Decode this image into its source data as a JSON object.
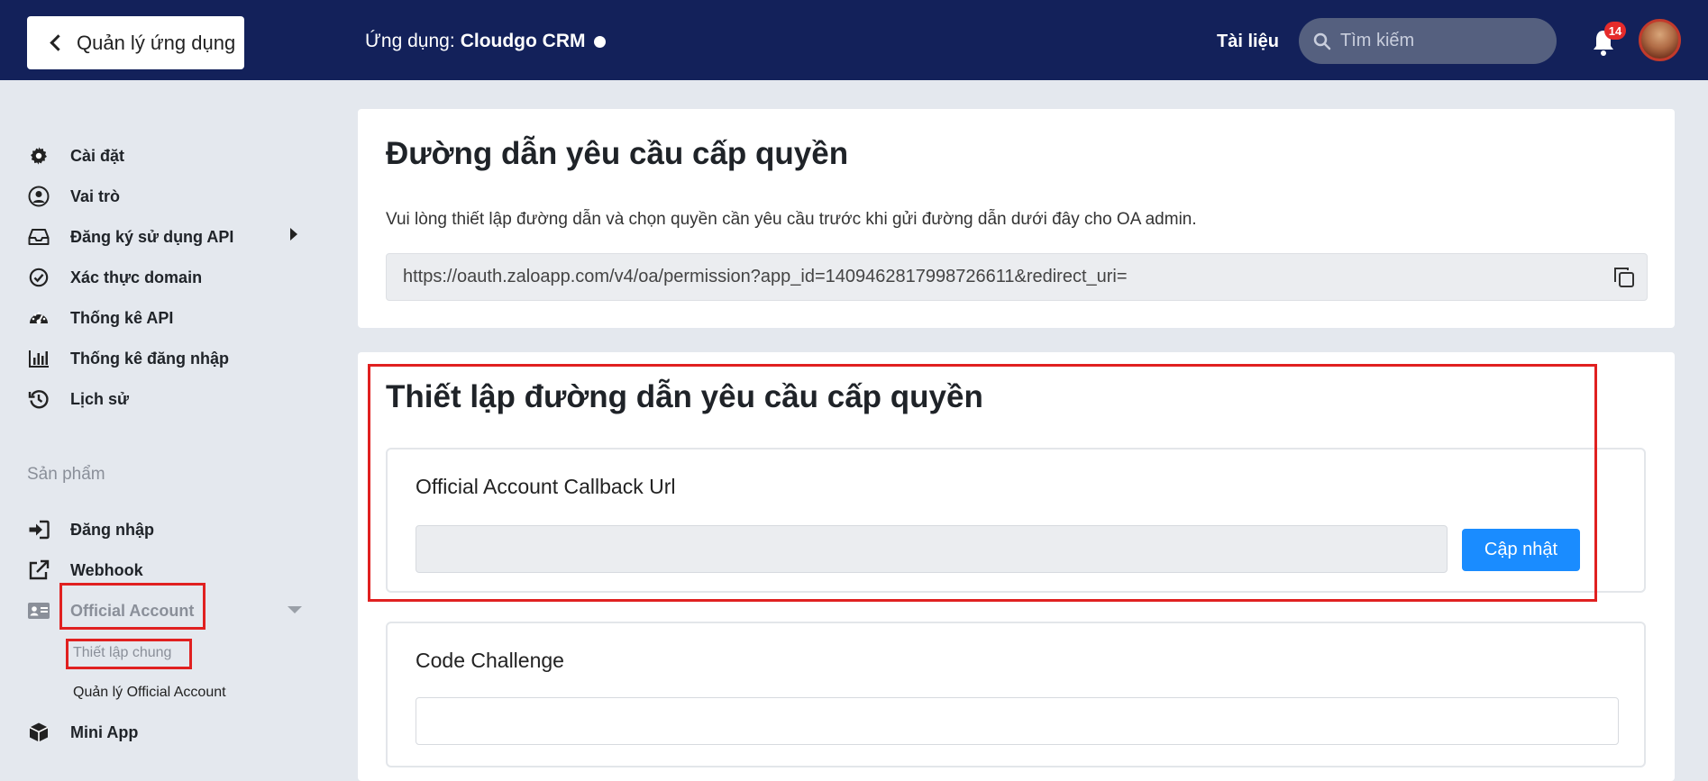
{
  "header": {
    "back_label": "Quản lý ứng dụng",
    "app_prefix": "Ứng dụng:",
    "app_name": "Cloudgo CRM",
    "docs_label": "Tài liệu",
    "search_placeholder": "Tìm kiếm",
    "notification_count": "14"
  },
  "sidebar": {
    "items": [
      {
        "label": "Cài đặt",
        "icon": "gear-icon"
      },
      {
        "label": "Vai trò",
        "icon": "user-circle-icon"
      },
      {
        "label": "Đăng ký sử dụng API",
        "icon": "inbox-icon"
      },
      {
        "label": "Xác thực domain",
        "icon": "check-circle-icon"
      },
      {
        "label": "Thống kê API",
        "icon": "dashboard-icon"
      },
      {
        "label": "Thống kê đăng nhập",
        "icon": "bar-chart-icon"
      },
      {
        "label": "Lịch sử",
        "icon": "history-icon"
      }
    ],
    "section_label": "Sản phẩm",
    "products": [
      {
        "label": "Đăng nhập",
        "icon": "sign-in-icon"
      },
      {
        "label": "Webhook",
        "icon": "external-link-icon"
      },
      {
        "label": "Official Account",
        "icon": "id-card-icon"
      },
      {
        "label": "Mini App",
        "icon": "cube-icon"
      }
    ],
    "oa_sub": {
      "general_settings": "Thiết lập chung",
      "manage_oa": "Quản lý Official Account"
    }
  },
  "permission_card": {
    "title": "Đường dẫn yêu cầu cấp quyền",
    "description": "Vui lòng thiết lập đường dẫn và chọn quyền cần yêu cầu trước khi gửi đường dẫn dưới đây cho OA admin.",
    "url": "https://oauth.zaloapp.com/v4/oa/permission?app_id=1409462817998726611&redirect_uri="
  },
  "setup_card": {
    "title": "Thiết lập đường dẫn yêu cầu cấp quyền",
    "callback_title": "Official Account Callback Url",
    "callback_value": "",
    "update_label": "Cập nhật",
    "code_challenge_title": "Code Challenge",
    "code_challenge_value": ""
  },
  "colors": {
    "header_bg": "#13215a",
    "page_bg": "#e4e8ee",
    "accent": "#1a8cff",
    "highlight_border": "#e02020",
    "badge": "#e52b2b"
  }
}
